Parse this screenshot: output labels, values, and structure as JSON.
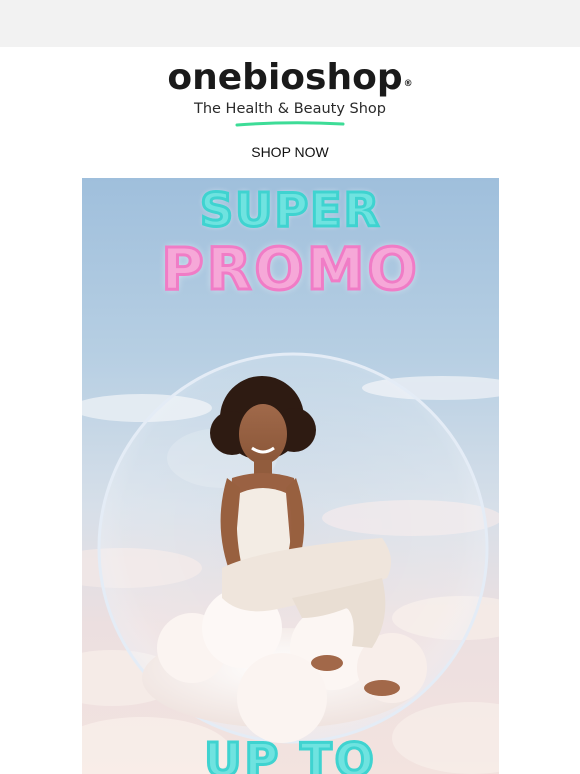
{
  "brand": {
    "name": "onebioshop",
    "registered_mark": "®",
    "tagline": "The Health & Beauty Shop",
    "accent_color": "#3ddc97"
  },
  "nav": {
    "shop_now_label": "SHOP NOW"
  },
  "hero": {
    "headline_line1": "SUPER",
    "headline_line2": "PROMO",
    "headline_line3": "UP TO",
    "headline_colors": {
      "cyan": "#6fe3e0",
      "pink": "#f6a8d8"
    },
    "image_subject": "woman-sitting-on-cloud-in-bubble"
  }
}
